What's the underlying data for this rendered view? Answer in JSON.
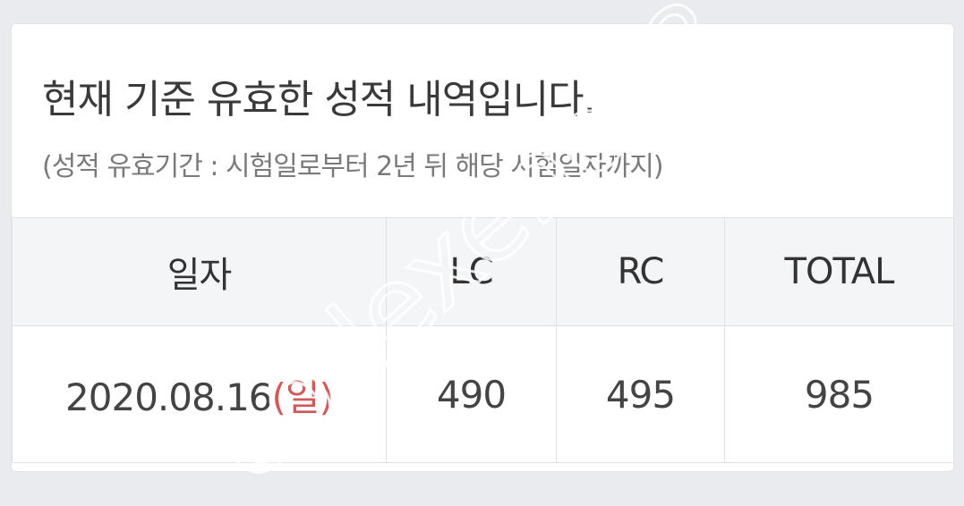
{
  "header": {
    "title": "현재 기준 유효한 성적 내역입니다.",
    "note": "(성적 유효기간 : 시험일로부터 2년 뒤 해당 시험일자까지)"
  },
  "table": {
    "columns": [
      "일자",
      "LC",
      "RC",
      "TOTAL"
    ],
    "rows": [
      {
        "date": "2020.08.16",
        "weekday": "(일)",
        "lc": "490",
        "rc": "495",
        "total": "985"
      }
    ]
  },
  "watermark": "codexeno88",
  "colors": {
    "total_value": "#2f6fa8",
    "weekday_label": "#d15a5a",
    "header_bg": "#f4f5f7"
  }
}
